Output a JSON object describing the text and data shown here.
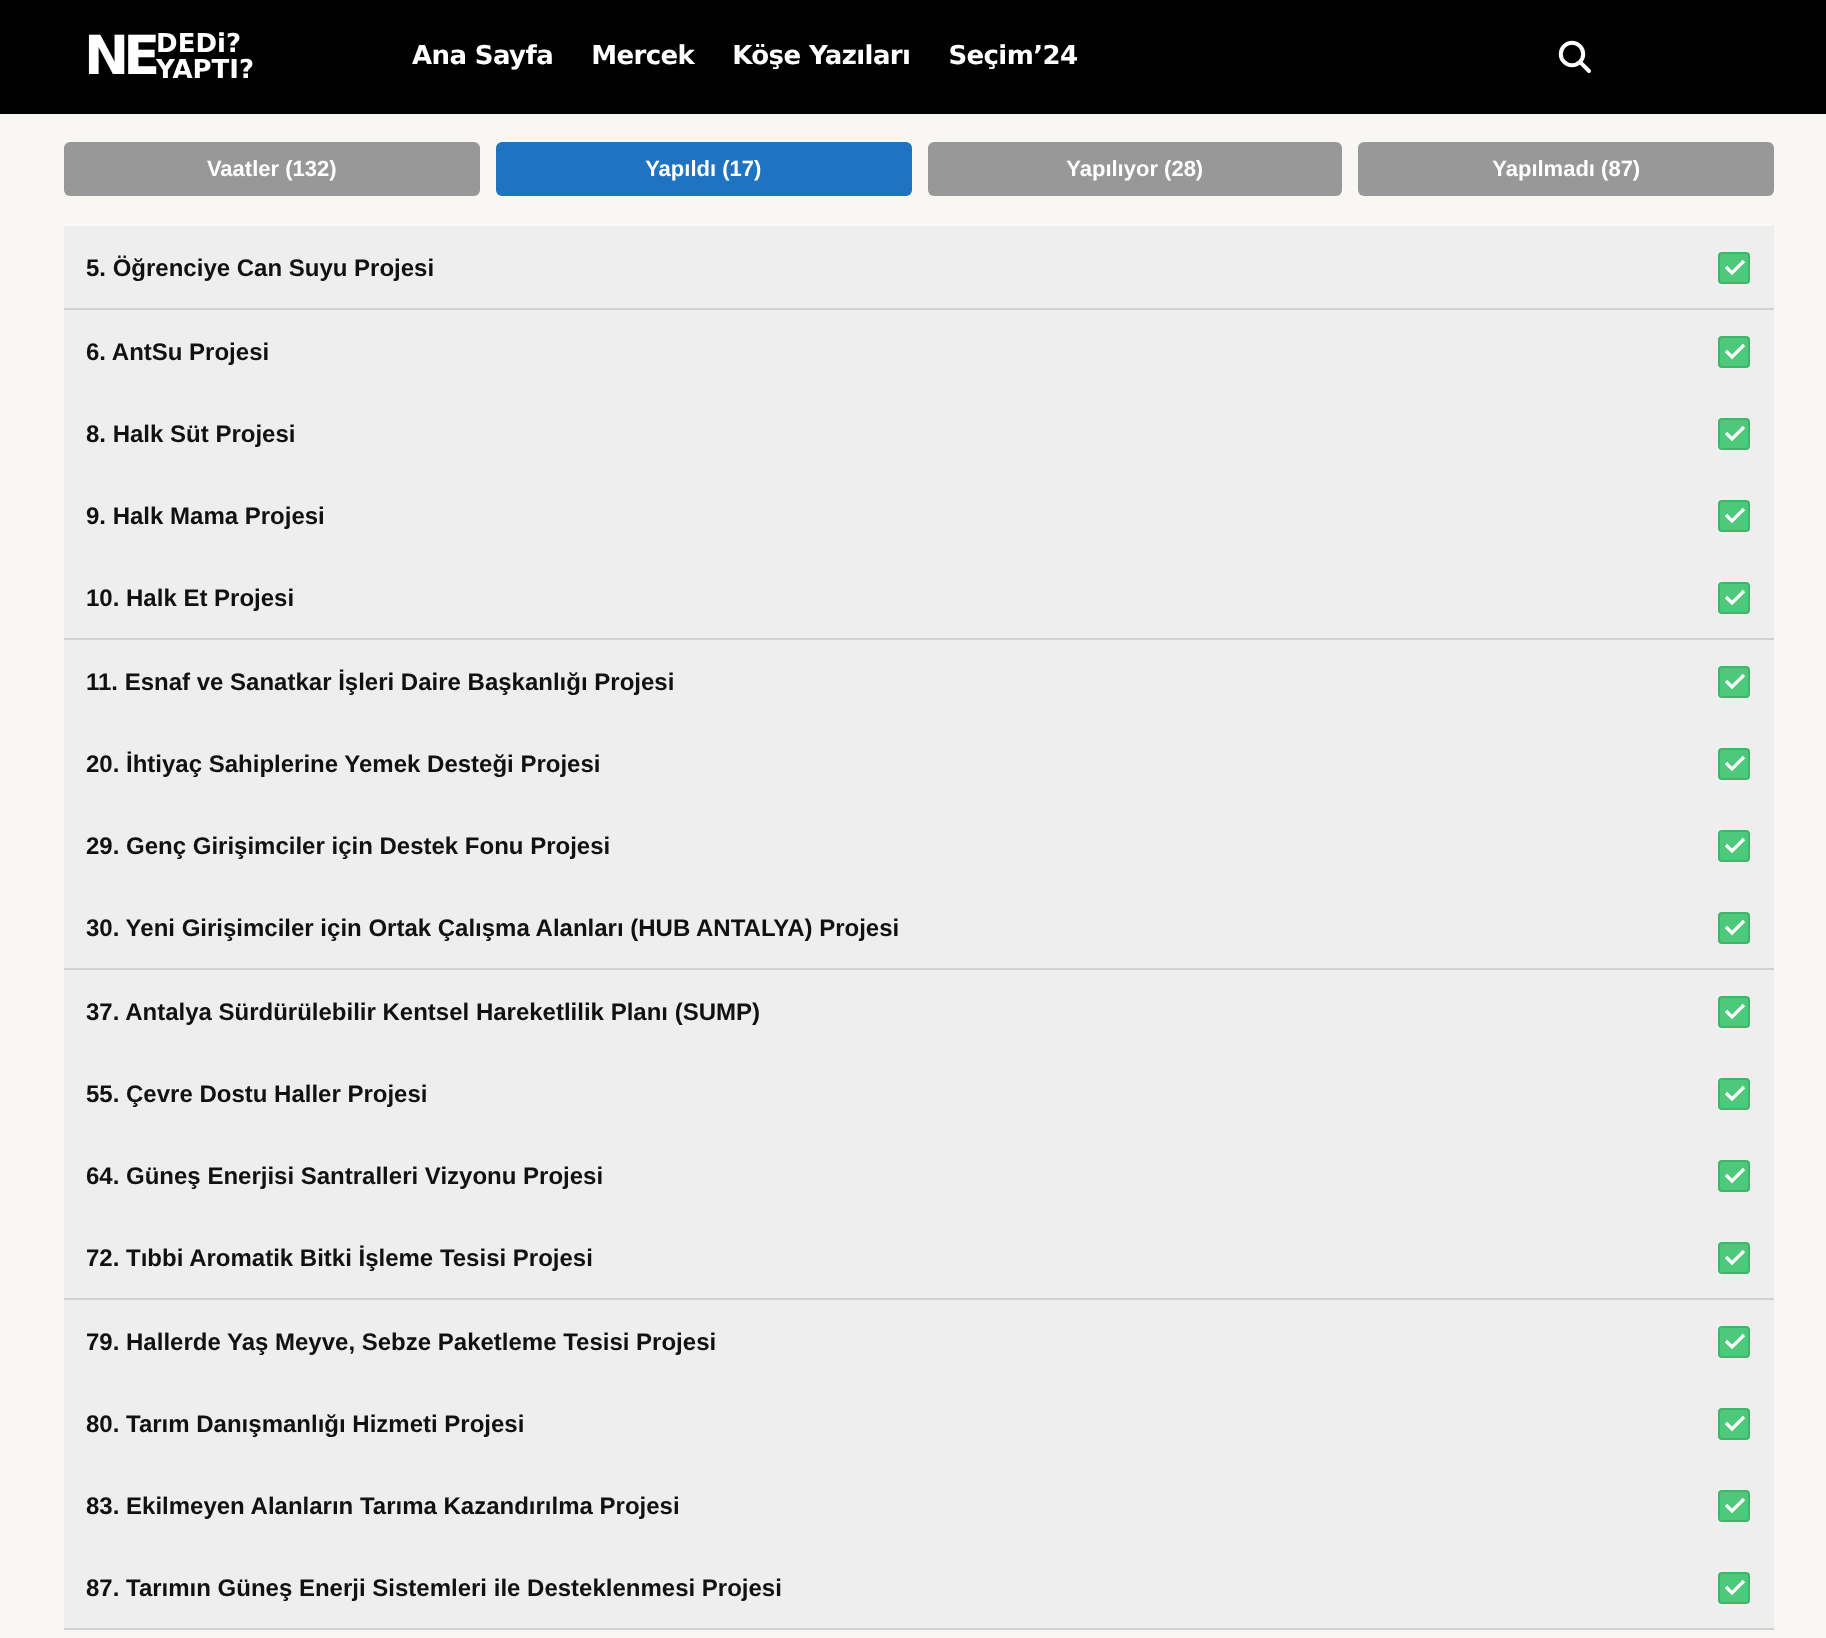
{
  "logo": {
    "big": "NE",
    "top": "DEDi?",
    "bottom": "YAPTI?"
  },
  "nav": [
    "Ana Sayfa",
    "Mercek",
    "Köşe Yazıları",
    "Seçim’24"
  ],
  "tabs": [
    {
      "label": "Vaatler (132)",
      "selected": false
    },
    {
      "label": "Yapıldı (17)",
      "selected": true
    },
    {
      "label": "Yapılıyor (28)",
      "selected": false
    },
    {
      "label": "Yapılmadı (87)",
      "selected": false
    }
  ],
  "groups": [
    {
      "items": [
        {
          "title": "5. Öğrenciye Can Suyu Projesi",
          "checked": true
        }
      ]
    },
    {
      "items": [
        {
          "title": "6. AntSu Projesi",
          "checked": true
        },
        {
          "title": "8. Halk Süt Projesi",
          "checked": true
        },
        {
          "title": "9. Halk Mama Projesi",
          "checked": true
        },
        {
          "title": "10. Halk Et Projesi",
          "checked": true
        }
      ]
    },
    {
      "items": [
        {
          "title": "11. Esnaf ve Sanatkar İşleri Daire Başkanlığı Projesi",
          "checked": true
        },
        {
          "title": "20. İhtiyaç Sahiplerine Yemek Desteği Projesi",
          "checked": true
        },
        {
          "title": "29. Genç Girişimciler için Destek Fonu Projesi",
          "checked": true
        },
        {
          "title": "30. Yeni Girişimciler için Ortak Çalışma Alanları (HUB ANTALYA) Projesi",
          "checked": true
        }
      ]
    },
    {
      "items": [
        {
          "title": "37. Antalya Sürdürülebilir Kentsel Hareketlilik Planı (SUMP)",
          "checked": true
        },
        {
          "title": "55. Çevre Dostu Haller Projesi",
          "checked": true
        },
        {
          "title": "64. Güneş Enerjisi Santralleri Vizyonu Projesi",
          "checked": true
        },
        {
          "title": "72. Tıbbi Aromatik Bitki İşleme Tesisi Projesi",
          "checked": true
        }
      ]
    },
    {
      "items": [
        {
          "title": "79. Hallerde Yaş Meyve, Sebze Paketleme Tesisi Projesi",
          "checked": true
        },
        {
          "title": "80. Tarım Danışmanlığı Hizmeti Projesi",
          "checked": true
        },
        {
          "title": "83. Ekilmeyen Alanların Tarıma Kazandırılma Projesi",
          "checked": true
        },
        {
          "title": "87. Tarımın Güneş Enerji Sistemleri ile Desteklenmesi Projesi",
          "checked": true
        }
      ]
    }
  ]
}
